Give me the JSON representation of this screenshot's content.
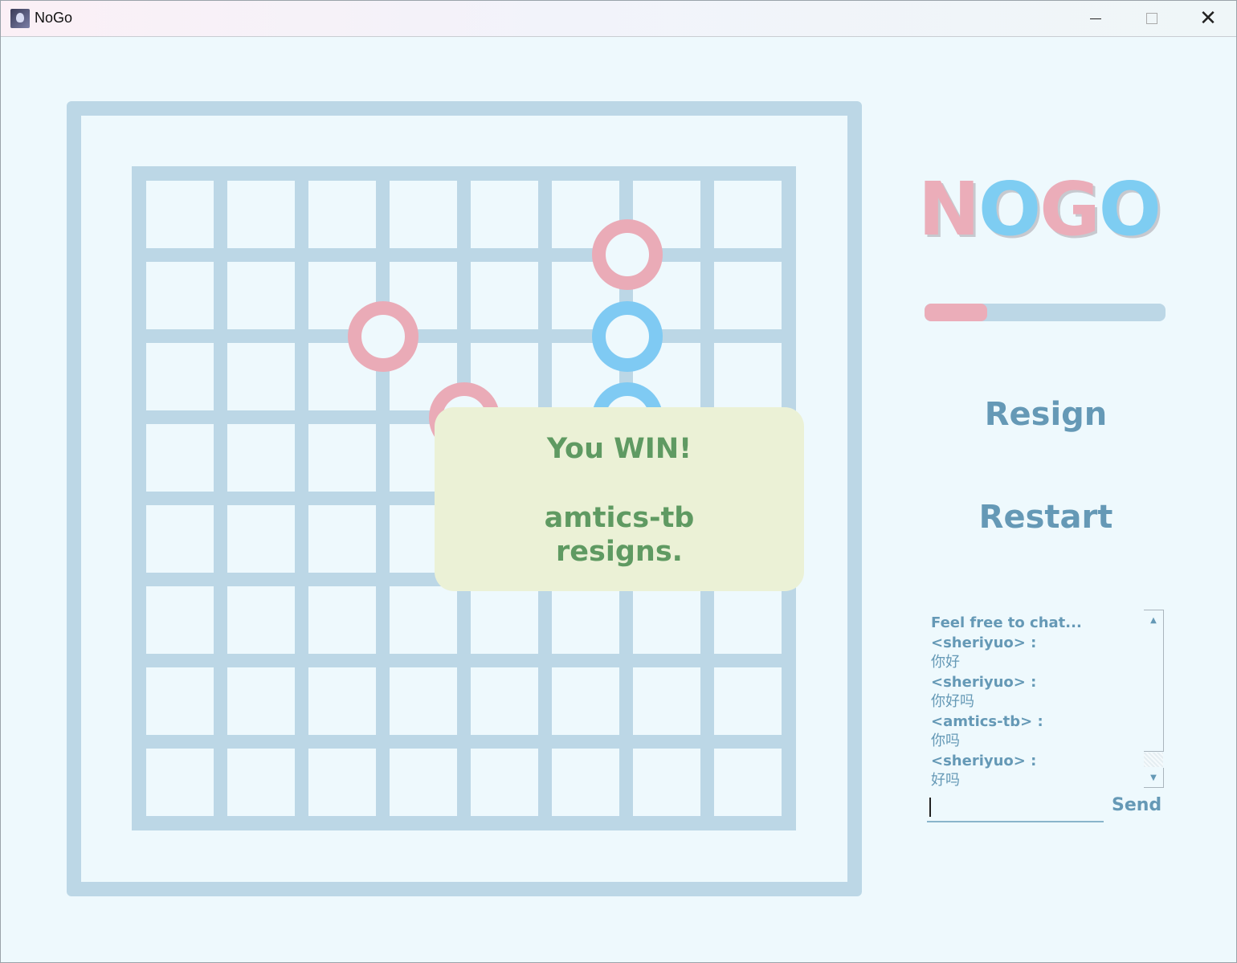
{
  "window": {
    "title": "NoGo"
  },
  "board": {
    "size": 9,
    "stones": [
      {
        "color": "pink",
        "col": 6,
        "row": 1
      },
      {
        "color": "pink",
        "col": 3,
        "row": 2
      },
      {
        "color": "blue",
        "col": 6,
        "row": 2
      },
      {
        "color": "pink",
        "col": 4,
        "row": 3
      },
      {
        "color": "blue",
        "col": 6,
        "row": 3
      }
    ]
  },
  "popup": {
    "line1": "You WIN!",
    "line2": "amtics-tb",
    "line3": "resigns."
  },
  "logo": {
    "letters": [
      "N",
      "O",
      "G",
      "O"
    ]
  },
  "timer": {
    "progress": 0.26,
    "fill_color": "#ebadb9",
    "track_color": "#bcd7e6"
  },
  "buttons": {
    "resign": "Resign",
    "restart": "Restart",
    "send": "Send"
  },
  "chat": {
    "header": "Feel free to chat...",
    "messages": [
      {
        "sender": "<sheriyuo> :",
        "text": "你好"
      },
      {
        "sender": "<sheriyuo> :",
        "text": "你好吗"
      },
      {
        "sender": "<amtics-tb> :",
        "text": "你吗"
      },
      {
        "sender": "<sheriyuo> :",
        "text": "好吗"
      }
    ],
    "input_value": ""
  },
  "colors": {
    "pink": "#eaabb7",
    "blue": "#7fcaf3",
    "board": "#bcd7e6",
    "text": "#6599b6",
    "win": "#5f9a62"
  }
}
